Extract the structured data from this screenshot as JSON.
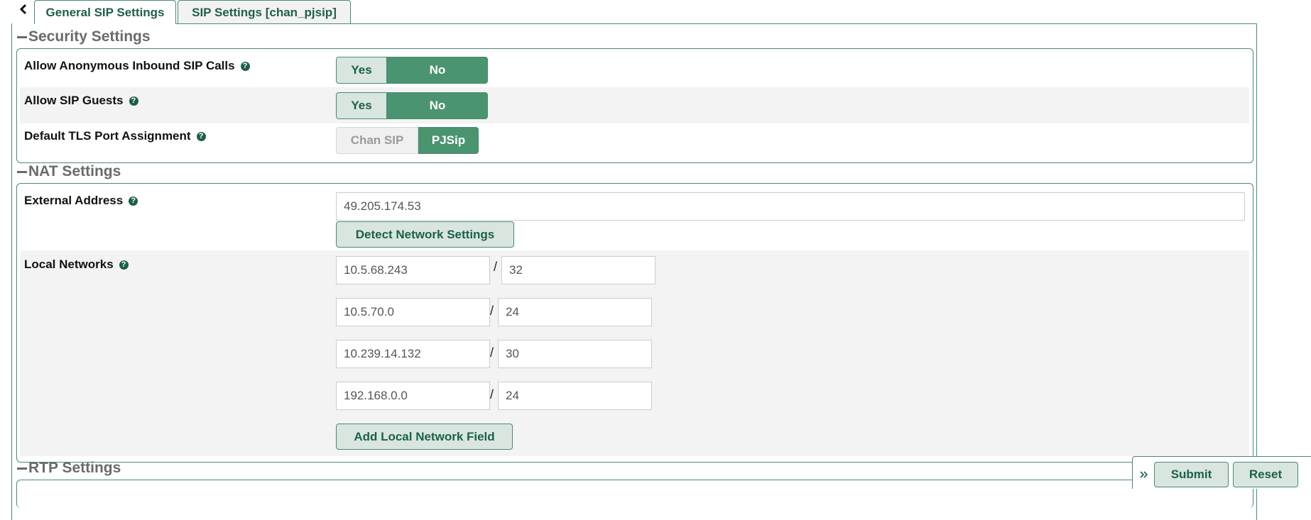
{
  "tabs": [
    {
      "label": "General SIP Settings",
      "active": true
    },
    {
      "label": "SIP Settings [chan_pjsip]",
      "active": false
    }
  ],
  "icons": {
    "back": "chevron-left-icon",
    "help": "question-circle-icon",
    "footer_expand": "double-chevron-right-icon",
    "section_collapse": "minus-icon"
  },
  "colors": {
    "accent": "#4a946f",
    "accent_light": "#d8e6df",
    "border": "#4a8a73",
    "text_dark_green": "#1d5f4a"
  },
  "security": {
    "title": "Security Settings",
    "anon_label": "Allow Anonymous Inbound SIP Calls",
    "anon_yes": "Yes",
    "anon_no": "No",
    "guests_label": "Allow SIP Guests",
    "guests_yes": "Yes",
    "guests_no": "No",
    "tls_label": "Default TLS Port Assignment",
    "tls_chan": "Chan SIP",
    "tls_pjsip": "PJSip"
  },
  "nat": {
    "title": "NAT Settings",
    "external_label": "External Address",
    "external_value": "49.205.174.53",
    "detect_button": "Detect Network Settings",
    "local_label": "Local Networks",
    "slash": "/",
    "networks": [
      {
        "ip": "10.5.68.243",
        "mask": "32"
      },
      {
        "ip": "10.5.70.0",
        "mask": "24"
      },
      {
        "ip": "10.239.14.132",
        "mask": "30"
      },
      {
        "ip": "192.168.0.0",
        "mask": "24"
      }
    ],
    "add_button": "Add Local Network Field"
  },
  "rtp": {
    "title": "RTP Settings"
  },
  "footer": {
    "submit": "Submit",
    "reset": "Reset"
  }
}
